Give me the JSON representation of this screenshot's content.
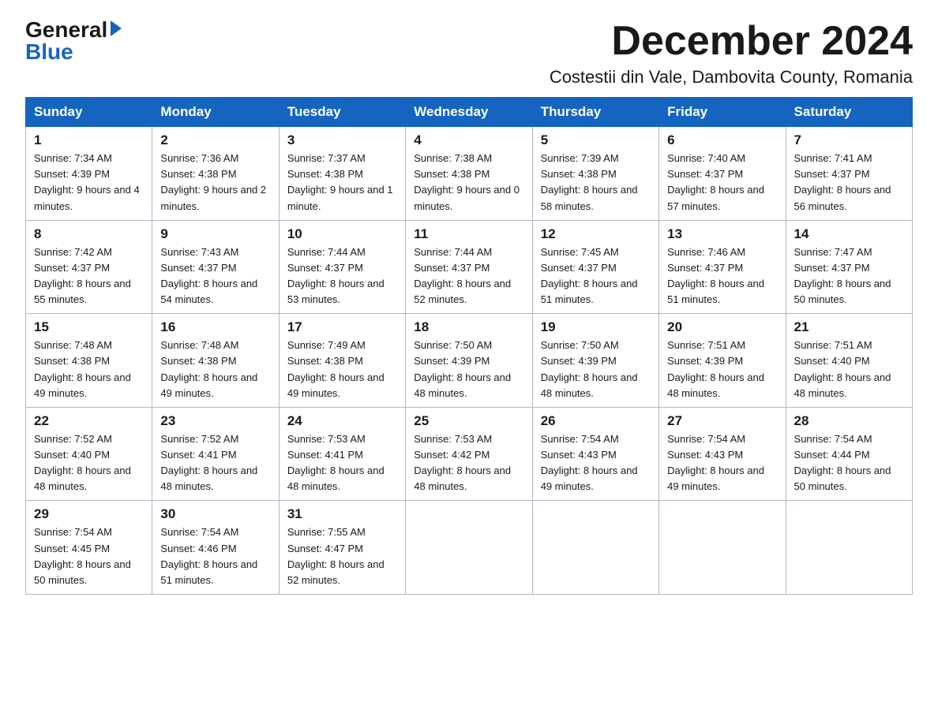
{
  "logo": {
    "general": "General",
    "blue": "Blue"
  },
  "title": "December 2024",
  "location": "Costestii din Vale, Dambovita County, Romania",
  "days_of_week": [
    "Sunday",
    "Monday",
    "Tuesday",
    "Wednesday",
    "Thursday",
    "Friday",
    "Saturday"
  ],
  "weeks": [
    [
      {
        "day": "1",
        "sunrise": "7:34 AM",
        "sunset": "4:39 PM",
        "daylight": "9 hours and 4 minutes."
      },
      {
        "day": "2",
        "sunrise": "7:36 AM",
        "sunset": "4:38 PM",
        "daylight": "9 hours and 2 minutes."
      },
      {
        "day": "3",
        "sunrise": "7:37 AM",
        "sunset": "4:38 PM",
        "daylight": "9 hours and 1 minute."
      },
      {
        "day": "4",
        "sunrise": "7:38 AM",
        "sunset": "4:38 PM",
        "daylight": "9 hours and 0 minutes."
      },
      {
        "day": "5",
        "sunrise": "7:39 AM",
        "sunset": "4:38 PM",
        "daylight": "8 hours and 58 minutes."
      },
      {
        "day": "6",
        "sunrise": "7:40 AM",
        "sunset": "4:37 PM",
        "daylight": "8 hours and 57 minutes."
      },
      {
        "day": "7",
        "sunrise": "7:41 AM",
        "sunset": "4:37 PM",
        "daylight": "8 hours and 56 minutes."
      }
    ],
    [
      {
        "day": "8",
        "sunrise": "7:42 AM",
        "sunset": "4:37 PM",
        "daylight": "8 hours and 55 minutes."
      },
      {
        "day": "9",
        "sunrise": "7:43 AM",
        "sunset": "4:37 PM",
        "daylight": "8 hours and 54 minutes."
      },
      {
        "day": "10",
        "sunrise": "7:44 AM",
        "sunset": "4:37 PM",
        "daylight": "8 hours and 53 minutes."
      },
      {
        "day": "11",
        "sunrise": "7:44 AM",
        "sunset": "4:37 PM",
        "daylight": "8 hours and 52 minutes."
      },
      {
        "day": "12",
        "sunrise": "7:45 AM",
        "sunset": "4:37 PM",
        "daylight": "8 hours and 51 minutes."
      },
      {
        "day": "13",
        "sunrise": "7:46 AM",
        "sunset": "4:37 PM",
        "daylight": "8 hours and 51 minutes."
      },
      {
        "day": "14",
        "sunrise": "7:47 AM",
        "sunset": "4:37 PM",
        "daylight": "8 hours and 50 minutes."
      }
    ],
    [
      {
        "day": "15",
        "sunrise": "7:48 AM",
        "sunset": "4:38 PM",
        "daylight": "8 hours and 49 minutes."
      },
      {
        "day": "16",
        "sunrise": "7:48 AM",
        "sunset": "4:38 PM",
        "daylight": "8 hours and 49 minutes."
      },
      {
        "day": "17",
        "sunrise": "7:49 AM",
        "sunset": "4:38 PM",
        "daylight": "8 hours and 49 minutes."
      },
      {
        "day": "18",
        "sunrise": "7:50 AM",
        "sunset": "4:39 PM",
        "daylight": "8 hours and 48 minutes."
      },
      {
        "day": "19",
        "sunrise": "7:50 AM",
        "sunset": "4:39 PM",
        "daylight": "8 hours and 48 minutes."
      },
      {
        "day": "20",
        "sunrise": "7:51 AM",
        "sunset": "4:39 PM",
        "daylight": "8 hours and 48 minutes."
      },
      {
        "day": "21",
        "sunrise": "7:51 AM",
        "sunset": "4:40 PM",
        "daylight": "8 hours and 48 minutes."
      }
    ],
    [
      {
        "day": "22",
        "sunrise": "7:52 AM",
        "sunset": "4:40 PM",
        "daylight": "8 hours and 48 minutes."
      },
      {
        "day": "23",
        "sunrise": "7:52 AM",
        "sunset": "4:41 PM",
        "daylight": "8 hours and 48 minutes."
      },
      {
        "day": "24",
        "sunrise": "7:53 AM",
        "sunset": "4:41 PM",
        "daylight": "8 hours and 48 minutes."
      },
      {
        "day": "25",
        "sunrise": "7:53 AM",
        "sunset": "4:42 PM",
        "daylight": "8 hours and 48 minutes."
      },
      {
        "day": "26",
        "sunrise": "7:54 AM",
        "sunset": "4:43 PM",
        "daylight": "8 hours and 49 minutes."
      },
      {
        "day": "27",
        "sunrise": "7:54 AM",
        "sunset": "4:43 PM",
        "daylight": "8 hours and 49 minutes."
      },
      {
        "day": "28",
        "sunrise": "7:54 AM",
        "sunset": "4:44 PM",
        "daylight": "8 hours and 50 minutes."
      }
    ],
    [
      {
        "day": "29",
        "sunrise": "7:54 AM",
        "sunset": "4:45 PM",
        "daylight": "8 hours and 50 minutes."
      },
      {
        "day": "30",
        "sunrise": "7:54 AM",
        "sunset": "4:46 PM",
        "daylight": "8 hours and 51 minutes."
      },
      {
        "day": "31",
        "sunrise": "7:55 AM",
        "sunset": "4:47 PM",
        "daylight": "8 hours and 52 minutes."
      },
      null,
      null,
      null,
      null
    ]
  ]
}
